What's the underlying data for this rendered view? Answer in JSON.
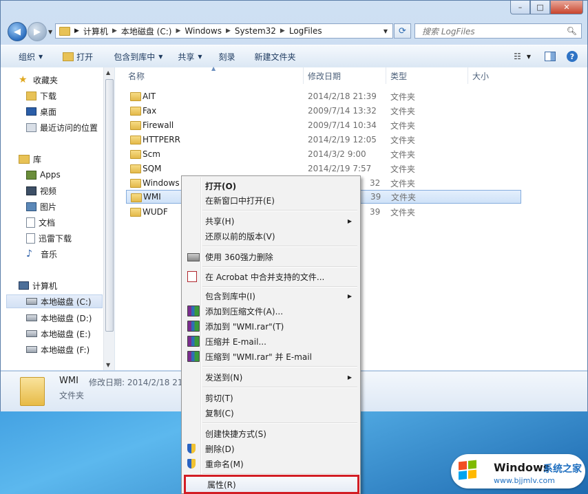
{
  "window": {
    "minimize_glyph": "–",
    "maximize_glyph": "□",
    "close_glyph": "✕"
  },
  "address": {
    "crumbs": [
      "计算机",
      "本地磁盘 (C:)",
      "Windows",
      "System32",
      "LogFiles"
    ]
  },
  "search": {
    "placeholder": "搜索 LogFiles"
  },
  "toolbar": {
    "organize": "组织",
    "open": "打开",
    "include_in_library": "包含到库中",
    "share": "共享",
    "burn": "刻录",
    "new_folder": "新建文件夹"
  },
  "sidebar": {
    "favorites": "收藏夹",
    "downloads": "下载",
    "desktop": "桌面",
    "recent": "最近访问的位置",
    "libraries": "库",
    "apps": "Apps",
    "videos": "视频",
    "pictures": "图片",
    "documents": "文档",
    "xunlei": "迅雷下载",
    "music": "音乐",
    "computer": "计算机",
    "drive_c": "本地磁盘 (C:)",
    "drive_d": "本地磁盘 (D:)",
    "drive_e": "本地磁盘 (E:)",
    "drive_f": "本地磁盘 (F:)"
  },
  "columns": {
    "name": "名称",
    "date": "修改日期",
    "type": "类型",
    "size": "大小"
  },
  "files": [
    {
      "name": "AIT",
      "date": "2014/2/18 21:39",
      "type": "文件夹"
    },
    {
      "name": "Fax",
      "date": "2009/7/14 13:32",
      "type": "文件夹"
    },
    {
      "name": "Firewall",
      "date": "2009/7/14 10:34",
      "type": "文件夹"
    },
    {
      "name": "HTTPERR",
      "date": "2014/2/19 12:05",
      "type": "文件夹"
    },
    {
      "name": "Scm",
      "date": "2014/3/2 9:00",
      "type": "文件夹"
    },
    {
      "name": "SQM",
      "date": "2014/2/19 7:57",
      "type": "文件夹"
    },
    {
      "name": "Windows",
      "date": "32",
      "type": "文件夹"
    },
    {
      "name": "WMI",
      "date": "39",
      "type": "文件夹"
    },
    {
      "name": "WUDF",
      "date": "39",
      "type": "文件夹"
    }
  ],
  "details": {
    "name": "WMI",
    "modified_label": "修改日期: 2014/2/18 21:",
    "type": "文件夹"
  },
  "context_menu": {
    "open": "打开(O)",
    "open_new_window": "在新窗口中打开(E)",
    "share": "共享(H)",
    "restore_previous": "还原以前的版本(V)",
    "delete_360": "使用 360强力删除",
    "acrobat_merge": "在 Acrobat 中合并支持的文件...",
    "include_library": "包含到库中(I)",
    "add_archive": "添加到压缩文件(A)...",
    "add_to_rar": "添加到 \"WMI.rar\"(T)",
    "compress_email": "压缩并 E-mail...",
    "compress_rar_email": "压缩到 \"WMI.rar\" 并 E-mail",
    "send_to": "发送到(N)",
    "cut": "剪切(T)",
    "copy": "复制(C)",
    "create_shortcut": "创建快捷方式(S)",
    "delete": "删除(D)",
    "rename": "重命名(M)",
    "properties": "属性(R)"
  },
  "watermark": {
    "brand": "Windows",
    "cn": "系统之家",
    "url": "www.bjjmlv.com"
  },
  "colors": {
    "highlight_border": "#d21d24",
    "selection": "#cfe2f8",
    "accent": "#1f6fc0"
  }
}
